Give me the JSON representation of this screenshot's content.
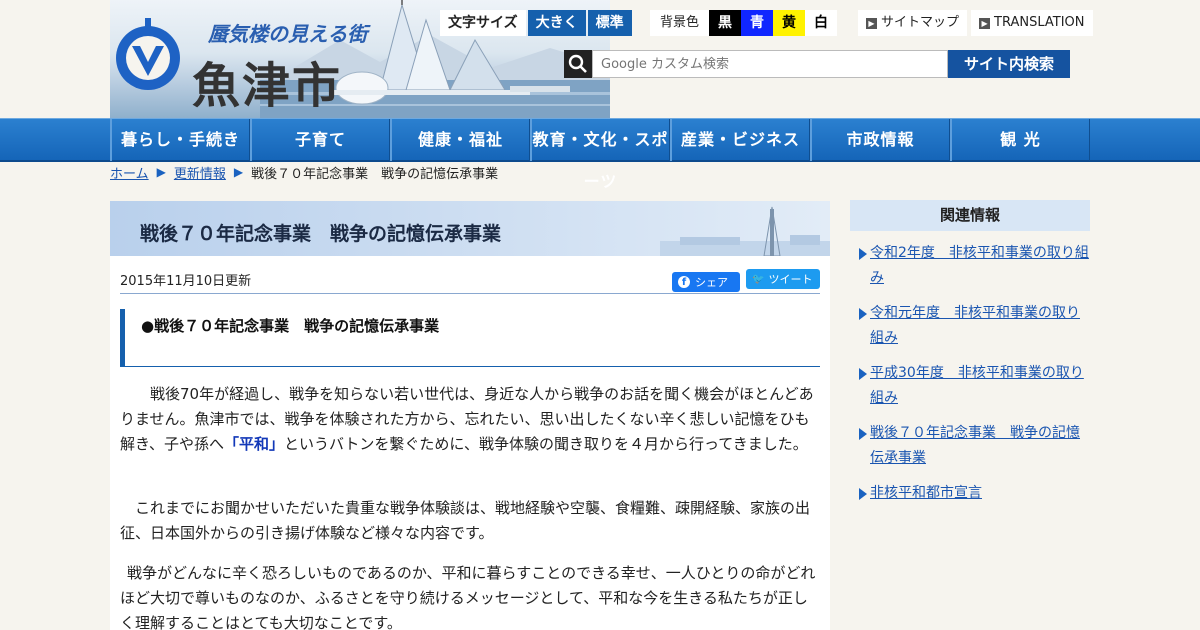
{
  "header": {
    "site_name": "魚津市",
    "catchphrase": "蜃気楼の見える街",
    "fontsize": {
      "label": "文字サイズ",
      "large": "大きく",
      "standard": "標準"
    },
    "bgcolor": {
      "label": "背景色",
      "black": "黒",
      "blue": "青",
      "yellow": "黄",
      "white": "白"
    },
    "links": {
      "sitemap": "サイトマップ",
      "translation": "TRANSLATION"
    },
    "search": {
      "placeholder": "Google カスタム検索",
      "button": "サイト内検索"
    }
  },
  "nav": [
    "暮らし・手続き",
    "子育て",
    "健康・福祉",
    "教育・文化・スポーツ",
    "産業・ビジネス",
    "市政情報",
    "観 光"
  ],
  "breadcrumb": {
    "home": "ホーム",
    "parent": "更新情報",
    "current": "戦後７０年記念事業　戦争の記憶伝承事業"
  },
  "main": {
    "title": "戦後７０年記念事業　戦争の記憶伝承事業",
    "updated": "2015年11月10日更新",
    "share_label": "シェア",
    "tweet_label": "ツイート",
    "heading2": "●戦後７０年記念事業　戦争の記憶伝承事業",
    "p1_a": "戦後70年が経過し、戦争を知らない若い世代は、身近な人から戦争のお話を聞く機会がほとんどありません。魚津市では、戦争を体験された方から、忘れたい、思い出したくない辛く悲しい記憶をひも解き、子や孫へ",
    "p1_em": "「平和」",
    "p1_b": "というバトンを繋ぐために、戦争体験の聞き取りを４月から行ってきました。",
    "p2": "これまでにお聞かせいただいた貴重な戦争体験談は、戦地経験や空襲、食糧難、疎開経験、家族の出征、日本国外からの引き揚げ体験など様々な内容です。",
    "p3": "戦争がどんなに辛く恐ろしいものであるのか、平和に暮らすことのできる幸せ、一人ひとりの命がどれほど大切で尊いものなのか、ふるさとを守り続けるメッセージとして、平和な今を生きる私たちが正しく理解することはとても大切なことです。"
  },
  "sidebar": {
    "title": "関連情報",
    "items": [
      "令和2年度　非核平和事業の取り組み",
      "令和元年度　非核平和事業の取り組み",
      "平成30年度　非核平和事業の取り組み",
      "戦後７０年記念事業　戦争の記憶伝承事業",
      "非核平和都市宣言"
    ]
  },
  "icons": {
    "search": "search-icon",
    "logo": "city-emblem-icon",
    "facebook": "facebook-icon",
    "twitter": "twitter-icon"
  },
  "colors": {
    "nav_blue": "#1565b8",
    "link_blue": "#1a55b0",
    "heading_band": "#cfdff2",
    "accent_blue": "#1560ad"
  }
}
